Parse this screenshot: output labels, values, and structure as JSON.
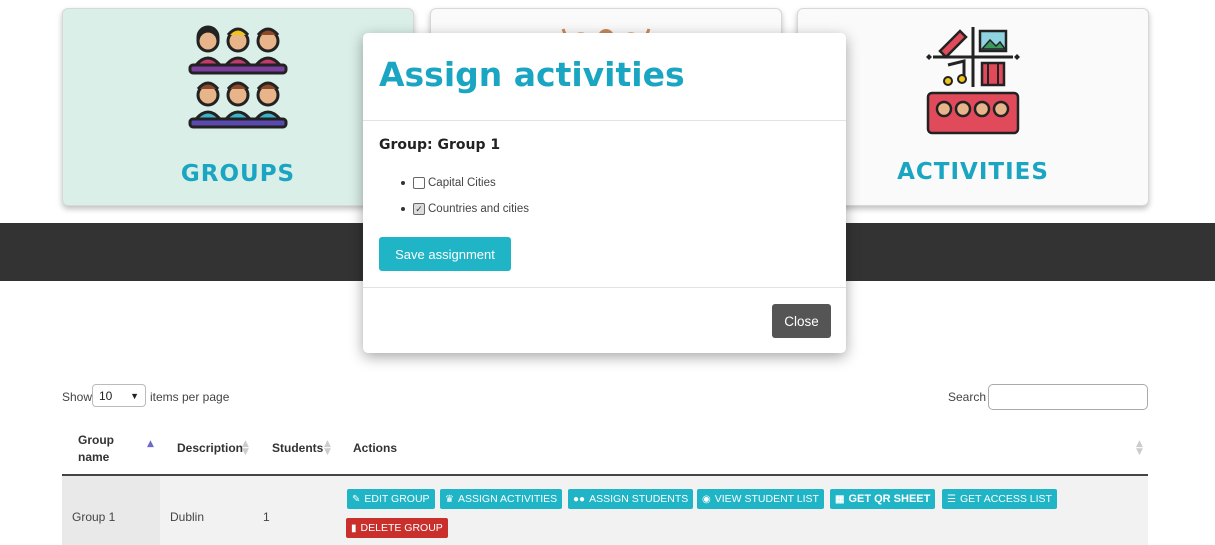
{
  "cards": {
    "groups_title": "GROUPS",
    "activities_title": "ACTIVITIES"
  },
  "table_controls": {
    "show_label": "Show",
    "page_size": "10",
    "items_label": "items per page",
    "search_label": "Search",
    "search_value": ""
  },
  "table": {
    "headers": [
      "Group name",
      "Description",
      "Students",
      "Actions"
    ],
    "rows": [
      {
        "group_name": "Group 1",
        "description": "Dublin",
        "students": "1",
        "actions": [
          "EDIT GROUP",
          "ASSIGN ACTIVITIES",
          "ASSIGN STUDENTS",
          "VIEW STUDENT LIST",
          "GET QR SHEET",
          "GET ACCESS LIST",
          "DELETE GROUP"
        ]
      }
    ]
  },
  "modal": {
    "title": "Assign activities",
    "group_line": "Group: Group 1",
    "activities": [
      {
        "label": "Capital Cities",
        "checked": false
      },
      {
        "label": "Countries and cities",
        "checked": true
      }
    ],
    "save_label": "Save assignment",
    "close_label": "Close"
  },
  "colors": {
    "accent": "#1aa6c2",
    "button": "#1fb5c7",
    "danger": "#c9302c",
    "band": "#333333"
  }
}
